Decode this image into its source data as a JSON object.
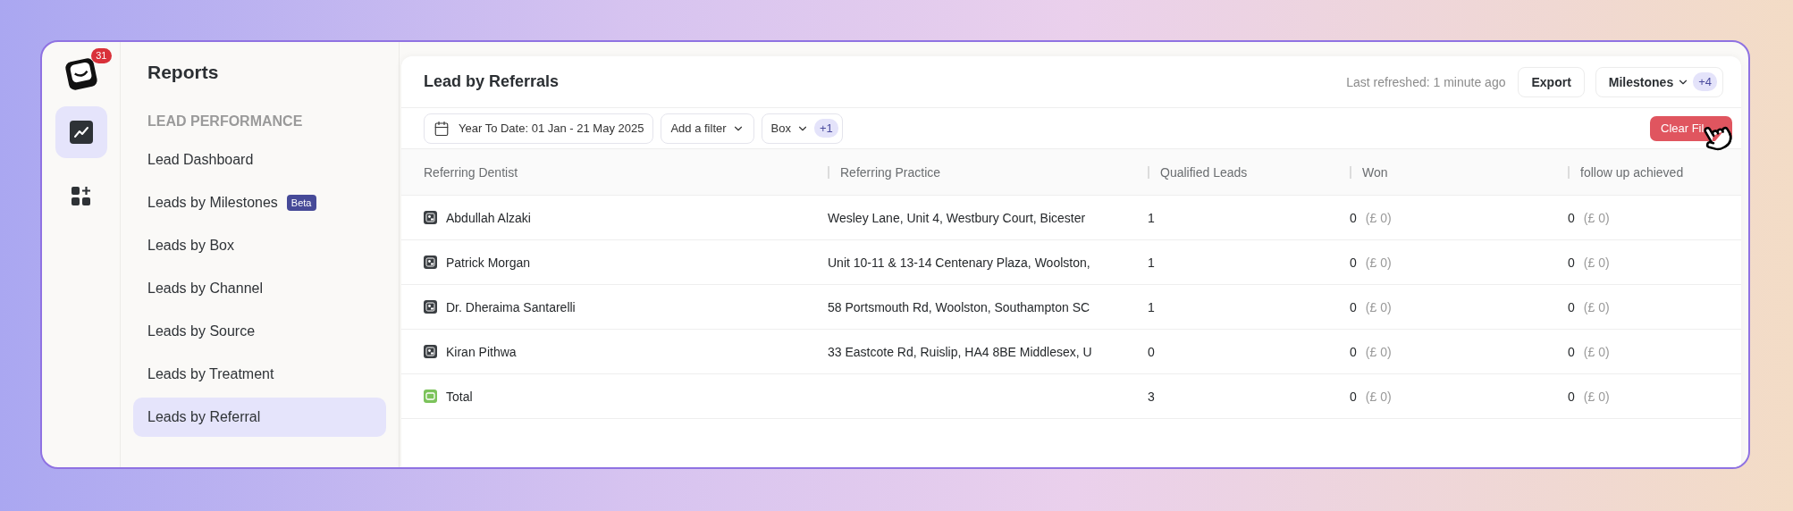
{
  "rail": {
    "badge": "31",
    "items": [
      {
        "kind": "chart",
        "selected": true
      },
      {
        "kind": "apps",
        "selected": false
      }
    ]
  },
  "sidebar": {
    "title": "Reports",
    "section": "LEAD PERFORMANCE",
    "items": [
      {
        "label": "Lead Dashboard",
        "selected": false
      },
      {
        "label": "Leads by Milestones",
        "badge": "Beta",
        "selected": false
      },
      {
        "label": "Leads by Box",
        "selected": false
      },
      {
        "label": "Leads by Channel",
        "selected": false
      },
      {
        "label": "Leads by Source",
        "selected": false
      },
      {
        "label": "Leads by Treatment",
        "selected": false
      },
      {
        "label": "Leads by Referral",
        "selected": true
      }
    ]
  },
  "report": {
    "title": "Lead by Referrals",
    "last_refreshed": "Last refreshed: 1 minute ago",
    "export": "Export",
    "milestones": {
      "label": "Milestones",
      "count": "+4"
    },
    "filters": [
      {
        "kind": "date",
        "label": "Year To Date: 01 Jan - 21 May 2025"
      },
      {
        "kind": "dropdown",
        "label": "Add a filter"
      },
      {
        "kind": "dropdown",
        "label": "Box",
        "count": "+1"
      }
    ],
    "clear_button": "Clear Fil"
  },
  "table": {
    "columns": [
      "Referring Dentist",
      "Referring Practice",
      "Qualified Leads",
      "Won",
      "follow up achieved"
    ],
    "rows": [
      {
        "kind": "dentist",
        "dentist": "Abdullah Alzaki",
        "practice": "Wesley Lane, Unit 4, Westbury Court, Bicester",
        "qualified": "1",
        "won": "0",
        "won_value": "(£ 0)",
        "follow": "0",
        "follow_value": "(£ 0)"
      },
      {
        "kind": "dentist",
        "dentist": "Patrick Morgan",
        "practice": "Unit 10-11 & 13-14 Centenary Plaza, Woolston,",
        "qualified": "1",
        "won": "0",
        "won_value": "(£ 0)",
        "follow": "0",
        "follow_value": "(£ 0)"
      },
      {
        "kind": "dentist",
        "dentist": "Dr. Dheraima Santarelli",
        "practice": "58 Portsmouth Rd, Woolston, Southampton SC",
        "qualified": "1",
        "won": "0",
        "won_value": "(£ 0)",
        "follow": "0",
        "follow_value": "(£ 0)"
      },
      {
        "kind": "dentist",
        "dentist": "Kiran Pithwa",
        "practice": "33 Eastcote Rd, Ruislip, HA4 8BE Middlesex, U",
        "qualified": "0",
        "won": "0",
        "won_value": "(£ 0)",
        "follow": "0",
        "follow_value": "(£ 0)"
      },
      {
        "kind": "total",
        "dentist": "Total",
        "qualified": "3",
        "won": "0",
        "won_value": "(£ 0)",
        "follow": "0",
        "follow_value": "(£ 0)"
      }
    ]
  }
}
